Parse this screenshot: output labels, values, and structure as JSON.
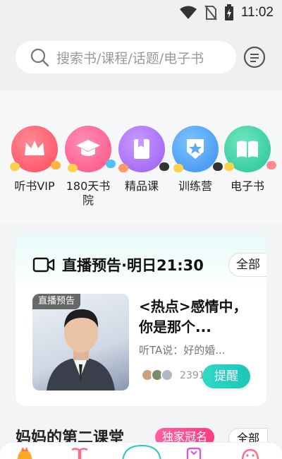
{
  "status_bar": {
    "time": "11:02"
  },
  "search": {
    "placeholder": "搜索书/课程/话题/电子书"
  },
  "categories": [
    {
      "label": "听书VIP",
      "icon": "crown-icon",
      "color": "#ff5066"
    },
    {
      "label": "180天书院",
      "icon": "graduation-cap-icon",
      "color": "#ff5a8a"
    },
    {
      "label": "精品课",
      "icon": "bookmark-book-icon",
      "color": "#a46bf5"
    },
    {
      "label": "训练营",
      "icon": "badge-star-icon",
      "color": "#3d9bf5"
    },
    {
      "label": "电子书",
      "icon": "open-book-icon",
      "color": "#2fcfa0"
    }
  ],
  "live": {
    "title": "直播预告·明日21:30",
    "all_label": "全部",
    "thumb_tag": "直播预告",
    "course_title": "<热点>感情中，你是那个...",
    "course_desc": "听TA说：好的婚...",
    "count": "2391",
    "remind_label": "提醒"
  },
  "section2": {
    "title": "妈妈的第二课堂",
    "badge": "独家冠名",
    "all_label": "全部"
  }
}
